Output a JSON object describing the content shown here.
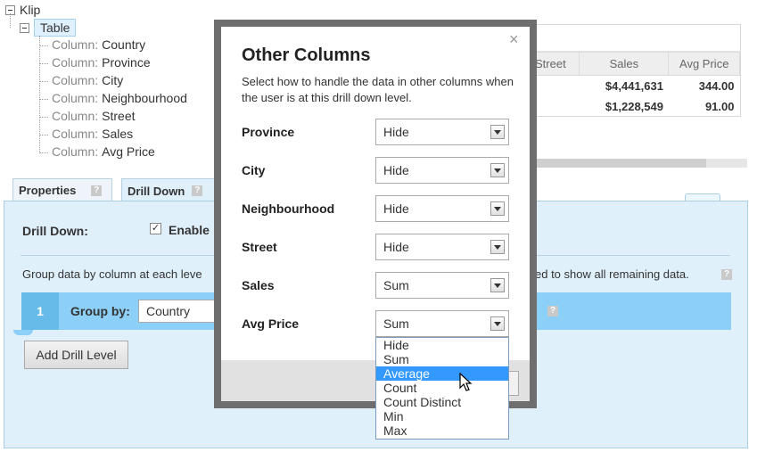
{
  "tree": {
    "root_label": "Klip",
    "table_label": "Table",
    "column_prefix": "Column:",
    "columns": [
      "Country",
      "Province",
      "City",
      "Neighbourhood",
      "Street",
      "Sales",
      "Avg Price"
    ]
  },
  "preview": {
    "headers": [
      "Street",
      "Sales",
      "Avg Price"
    ],
    "rows": [
      [
        "",
        "$4,441,631",
        "344.00"
      ],
      [
        "",
        "$1,228,549",
        "91.00"
      ]
    ]
  },
  "tabs": [
    {
      "label": "Properties",
      "help": "?"
    },
    {
      "label": "Drill Down",
      "help": "?"
    }
  ],
  "drill": {
    "label": "Drill Down:",
    "enable_label": "Enable",
    "checkbox_mark": "✓",
    "group_desc": "Group data by column at each leve",
    "group_desc_right": "ed to show all remaining data.",
    "help": "?",
    "level_number": "1",
    "group_by_label": "Group by:",
    "group_by_value": "Country",
    "add_level_label": "Add Drill Level"
  },
  "modal": {
    "close_glyph": "×",
    "title": "Other Columns",
    "description": "Select how to handle the data in other columns when the user is at this drill down level.",
    "rows": [
      {
        "label": "Province",
        "value": "Hide"
      },
      {
        "label": "City",
        "value": "Hide"
      },
      {
        "label": "Neighbourhood",
        "value": "Hide"
      },
      {
        "label": "Street",
        "value": "Hide"
      },
      {
        "label": "Sales",
        "value": "Sum"
      },
      {
        "label": "Avg Price",
        "value": "Sum"
      }
    ]
  },
  "dropdown": {
    "options": [
      "Hide",
      "Sum",
      "Average",
      "Count",
      "Count Distinct",
      "Min",
      "Max"
    ],
    "highlighted": "Average"
  },
  "colors": {
    "accent": "#8dd0f7",
    "level_badge": "#66bbe8",
    "panel_bg": "#dff0fb",
    "highlight": "#3399ff",
    "modal_border": "#6e6e6e"
  }
}
